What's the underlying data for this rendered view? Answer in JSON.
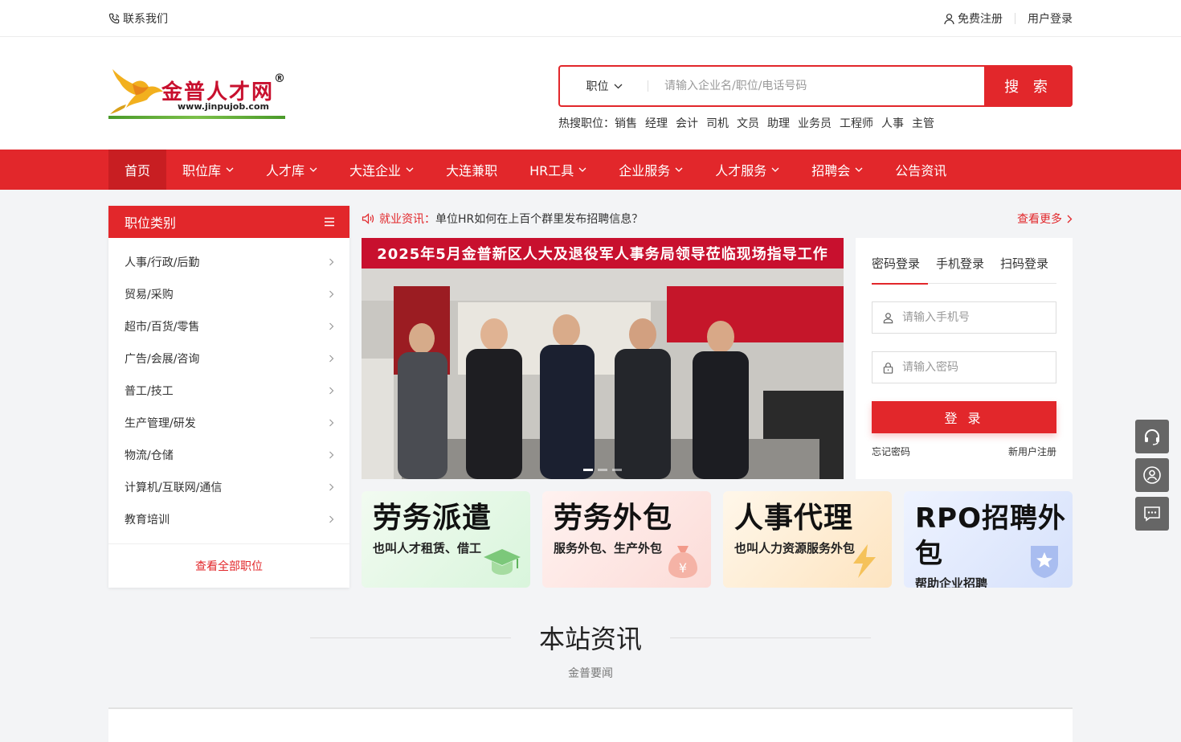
{
  "topbar": {
    "contact": "联系我们",
    "register": "免费注册",
    "login": "用户登录"
  },
  "logo": {
    "brand": "金普人才网",
    "url": "www.jinpujob.com",
    "registered_mark": "®"
  },
  "search": {
    "type_label": "职位",
    "placeholder": "请输入企业名/职位/电话号码",
    "button_label": "搜 索"
  },
  "hot_search": {
    "label": "热搜职位：",
    "items": [
      "销售",
      "经理",
      "会计",
      "司机",
      "文员",
      "助理",
      "业务员",
      "工程师",
      "人事",
      "主管"
    ]
  },
  "nav": {
    "items": [
      {
        "label": "首页",
        "has_dropdown": false
      },
      {
        "label": "职位库",
        "has_dropdown": true
      },
      {
        "label": "人才库",
        "has_dropdown": true
      },
      {
        "label": "大连企业",
        "has_dropdown": true
      },
      {
        "label": "大连兼职",
        "has_dropdown": false
      },
      {
        "label": "HR工具",
        "has_dropdown": true
      },
      {
        "label": "企业服务",
        "has_dropdown": true
      },
      {
        "label": "人才服务",
        "has_dropdown": true
      },
      {
        "label": "招聘会",
        "has_dropdown": true
      },
      {
        "label": "公告资讯",
        "has_dropdown": false
      }
    ]
  },
  "sidebar": {
    "title": "职位类别",
    "items": [
      {
        "label": "人事/行政/后勤"
      },
      {
        "label": "贸易/采购"
      },
      {
        "label": "超市/百货/零售"
      },
      {
        "label": "广告/会展/咨询"
      },
      {
        "label": "普工/技工"
      },
      {
        "label": "生产管理/研发"
      },
      {
        "label": "物流/仓储"
      },
      {
        "label": "计算机/互联网/通信"
      },
      {
        "label": "教育培训"
      }
    ],
    "more": "查看全部职位"
  },
  "notice": {
    "label": "就业资讯：",
    "text": "单位HR如何在上百个群里发布招聘信息？",
    "more": "查看更多"
  },
  "banner": {
    "title": "2025年5月金普新区人大及退役军人事务局领导莅临现场指导工作",
    "slide_count": 3,
    "active_slide": 1
  },
  "login_panel": {
    "tabs": [
      {
        "label": "密码登录",
        "active": true
      },
      {
        "label": "手机登录",
        "active": false
      },
      {
        "label": "扫码登录",
        "active": false
      }
    ],
    "phone_placeholder": "请输入手机号",
    "password_placeholder": "请输入密码",
    "submit_label": "登 录",
    "forgot": "忘记密码",
    "register": "新用户注册"
  },
  "service_cards": [
    {
      "title": "劳务派遣",
      "subtitle": "也叫人才租赁、借工",
      "icon": "graduation-cap-icon"
    },
    {
      "title": "劳务外包",
      "subtitle": "服务外包、生产外包",
      "icon": "money-bag-icon"
    },
    {
      "title": "人事代理",
      "subtitle": "也叫人力资源服务外包",
      "icon": "lightning-icon"
    },
    {
      "title": "RPO招聘外包",
      "subtitle": "帮助企业招聘",
      "icon": "star-badge-icon"
    }
  ],
  "section": {
    "title": "本站资讯",
    "subtitle": "金普要闻"
  },
  "colors": {
    "brand_red": "#e2272b",
    "float_gray": "#666666"
  }
}
